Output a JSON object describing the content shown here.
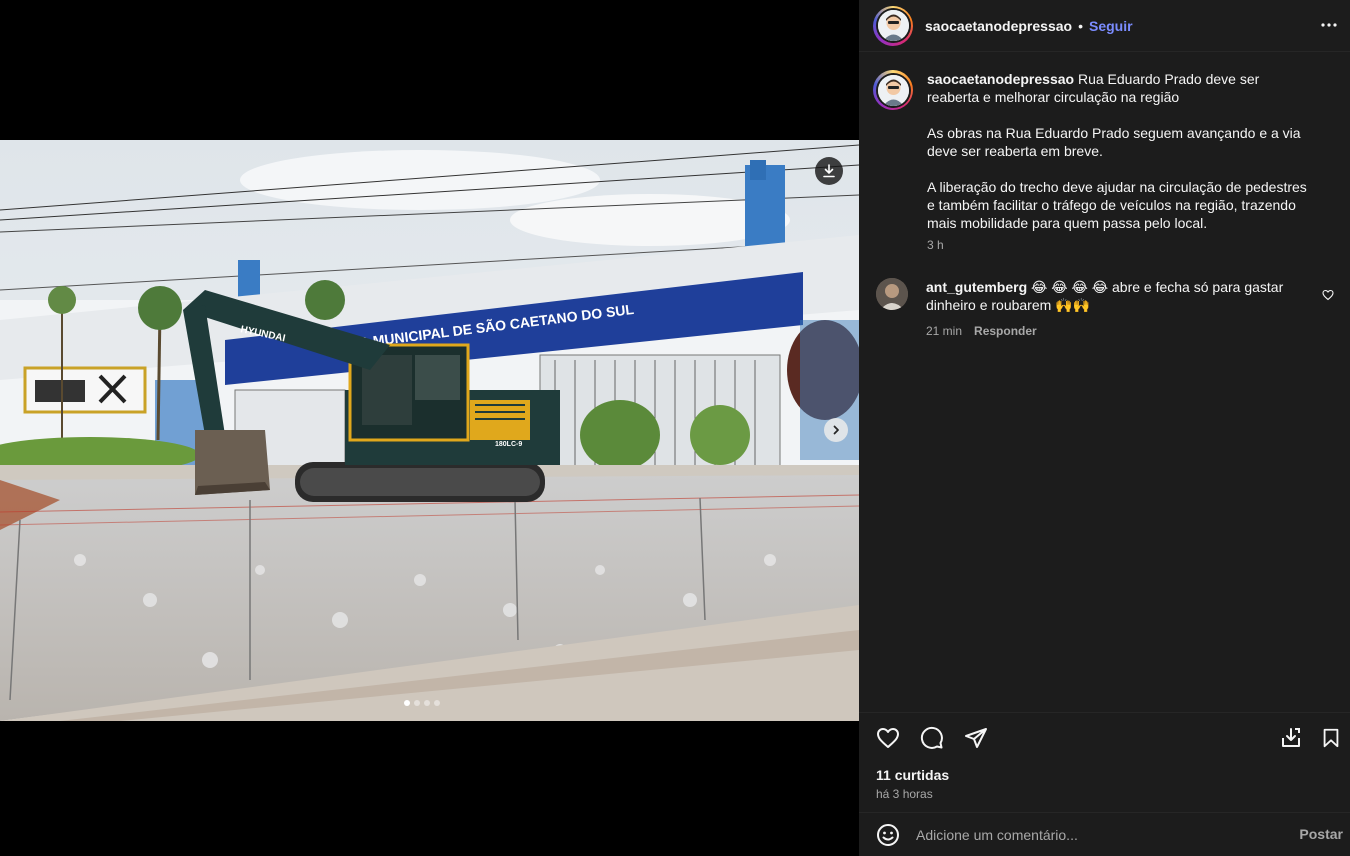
{
  "post": {
    "username": "saocaetanodepressao",
    "separator": "•",
    "follow_label": "Seguir",
    "photo_sign_text": "URA MUNICIPAL DE SÃO CAETANO DO SUL",
    "photo_excavator_brand": "HYUNDAI",
    "photo_excavator_model": "180LC-9",
    "carousel": {
      "count": 4,
      "active_index": 0
    }
  },
  "caption": {
    "username": "saocaetanodepressao",
    "title": "Rua Eduardo Prado deve ser reaberta e melhorar circulação na região",
    "paragraph_1": "As obras na Rua Eduardo Prado seguem avançando e a via deve ser reaberta em breve.",
    "paragraph_2": "A liberação do trecho deve ajudar na circulação de pedestres e também facilitar o tráfego de veículos na região, trazendo mais mobilidade para quem passa pelo local.",
    "time": "3 h"
  },
  "comment": {
    "username": "ant_gutemberg",
    "text": "😂 😂 😂 😂  abre e fecha só para gastar dinheiro e roubarem 🙌🙌",
    "time": "21 min",
    "reply_label": "Responder"
  },
  "actions": {
    "likes": "11 curtidas",
    "posted": "há 3 horas"
  },
  "add_comment": {
    "placeholder": "Adicione um comentário...",
    "post_label": "Postar"
  },
  "icons": [
    "download-icon",
    "chevron-right-icon",
    "more-icon",
    "heart-icon",
    "comment-icon",
    "share-icon",
    "save-to-collection-icon",
    "bookmark-icon",
    "emoji-icon"
  ]
}
